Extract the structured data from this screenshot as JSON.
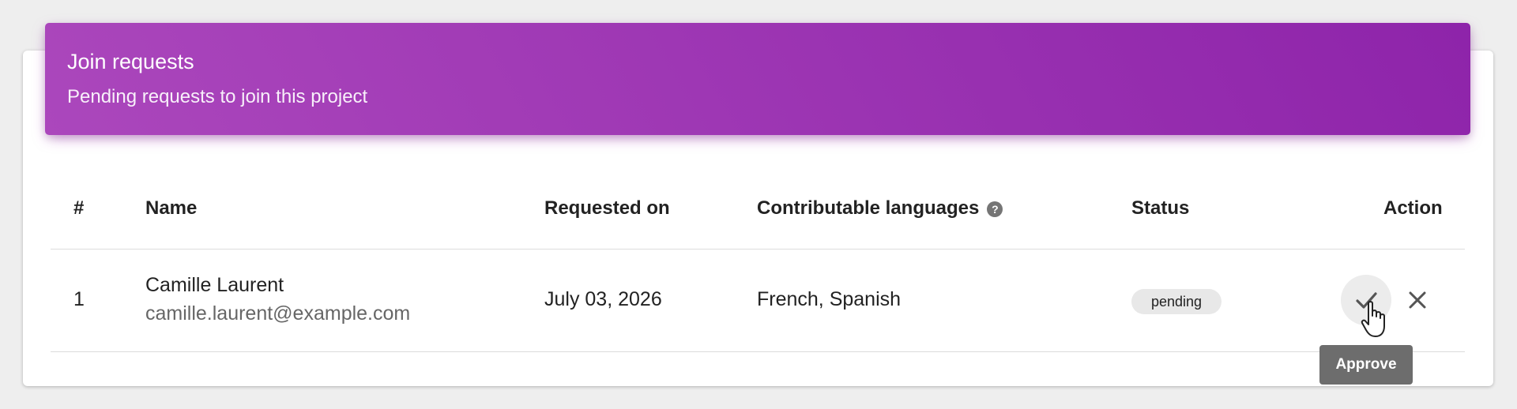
{
  "header": {
    "title": "Join requests",
    "subtitle": "Pending requests to join this project"
  },
  "table": {
    "columns": [
      "#",
      "Name",
      "Requested on",
      "Contributable languages",
      "Status",
      "Action"
    ],
    "help_icon_glyph": "?",
    "rows": [
      {
        "index": "1",
        "name": "Camille Laurent",
        "email": "camille.laurent@example.com",
        "requested_on": "July 03, 2026",
        "languages": "French, Spanish",
        "status": "pending"
      }
    ]
  },
  "actions": {
    "approve_icon": "check-icon",
    "reject_icon": "close-icon",
    "tooltip": "Approve"
  },
  "colors": {
    "header_gradient_start": "#ab47bc",
    "header_gradient_end": "#8e24aa",
    "status_badge_bg": "#e8e8e8",
    "tooltip_bg": "#6d6d6d"
  }
}
